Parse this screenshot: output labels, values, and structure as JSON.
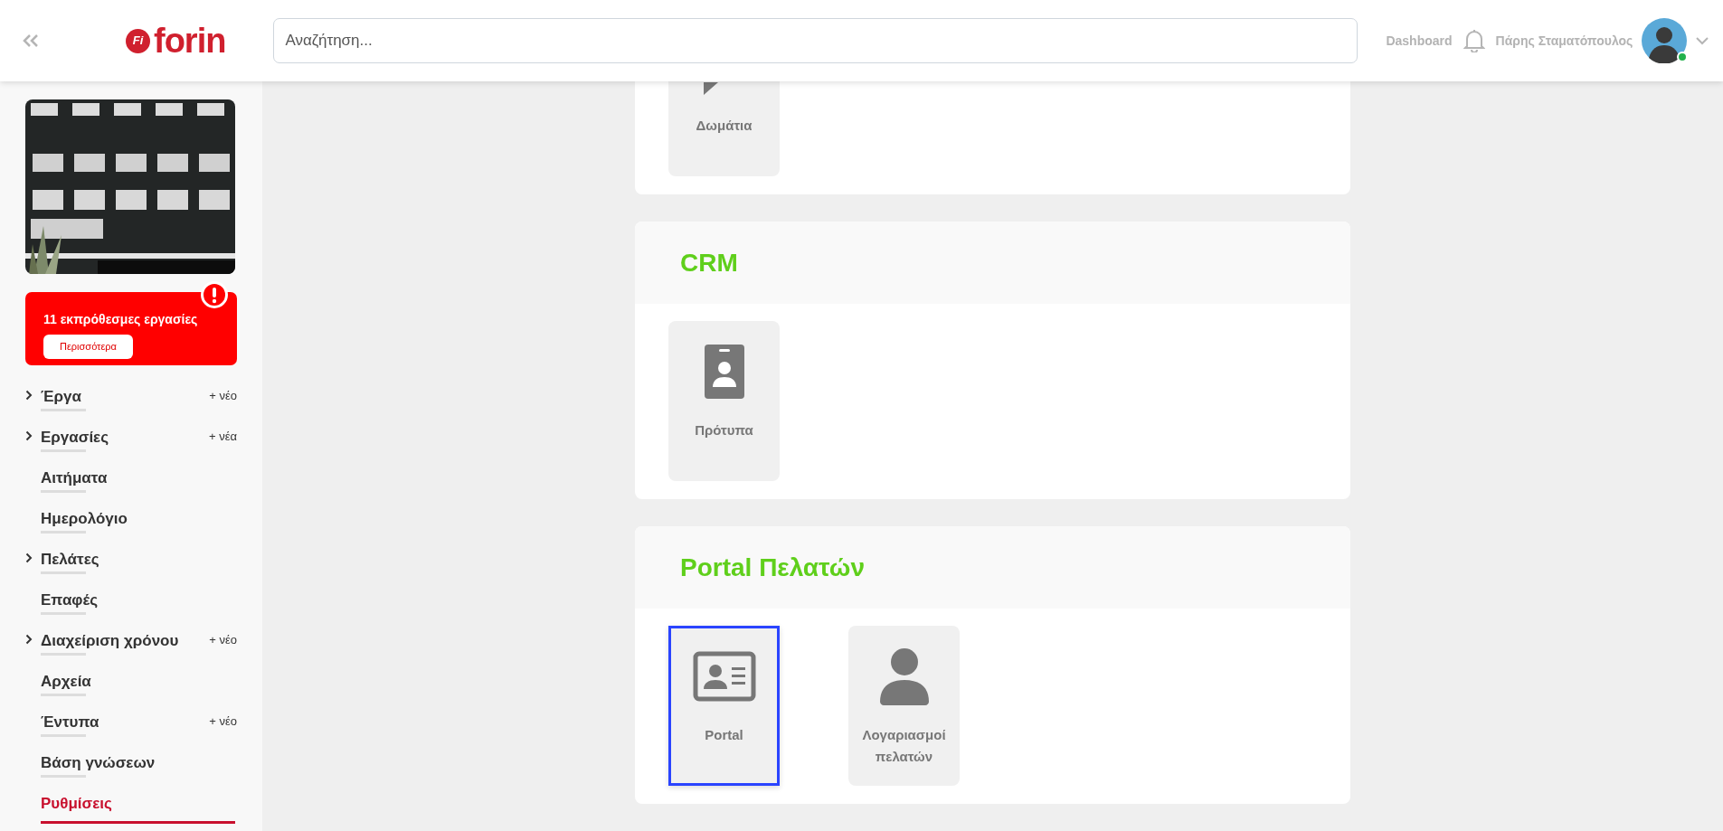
{
  "header": {
    "logo": {
      "mark": "Fi",
      "name": "forin"
    },
    "search": {
      "placeholder": "Αναζήτηση..."
    },
    "dashboard_link": "Dashboard",
    "user": {
      "name": "Πάρης Σταματόπουλος",
      "online": true
    }
  },
  "sidebar": {
    "alert": {
      "text": "11 εκπρόθεσμες εργασίες",
      "button": "Περισσότερα"
    },
    "items": [
      {
        "label": "Έργα",
        "expandable": true,
        "action": "+ νέο",
        "selected": false
      },
      {
        "label": "Εργασίες",
        "expandable": true,
        "action": "+ νέα",
        "selected": false
      },
      {
        "label": "Αιτήματα",
        "expandable": false,
        "selected": false
      },
      {
        "label": "Ημερολόγιο",
        "expandable": false,
        "selected": false
      },
      {
        "label": "Πελάτες",
        "expandable": true,
        "selected": false
      },
      {
        "label": "Επαφές",
        "expandable": false,
        "selected": false
      },
      {
        "label": "Διαχείριση χρόνου",
        "expandable": true,
        "action": "+ νέο",
        "selected": false
      },
      {
        "label": "Αρχεία",
        "expandable": false,
        "selected": false
      },
      {
        "label": "Έντυπα",
        "expandable": false,
        "action": "+ νέο",
        "selected": false
      },
      {
        "label": "Βάση γνώσεων",
        "expandable": false,
        "selected": false
      },
      {
        "label": "Ρυθμίσεις",
        "expandable": false,
        "selected": true
      }
    ]
  },
  "sections": [
    {
      "tiles": [
        {
          "label": "Δωμάτια",
          "kind": "chat",
          "selected": false
        }
      ]
    },
    {
      "title": "CRM",
      "tiles": [
        {
          "label": "Πρότυπα",
          "kind": "badge",
          "selected": false
        }
      ]
    },
    {
      "title": "Portal Πελατών",
      "tiles": [
        {
          "label": "Portal",
          "kind": "card",
          "selected": true
        },
        {
          "label": "Λογαριασμοί πελατών",
          "kind": "person",
          "selected": false
        }
      ]
    }
  ]
}
